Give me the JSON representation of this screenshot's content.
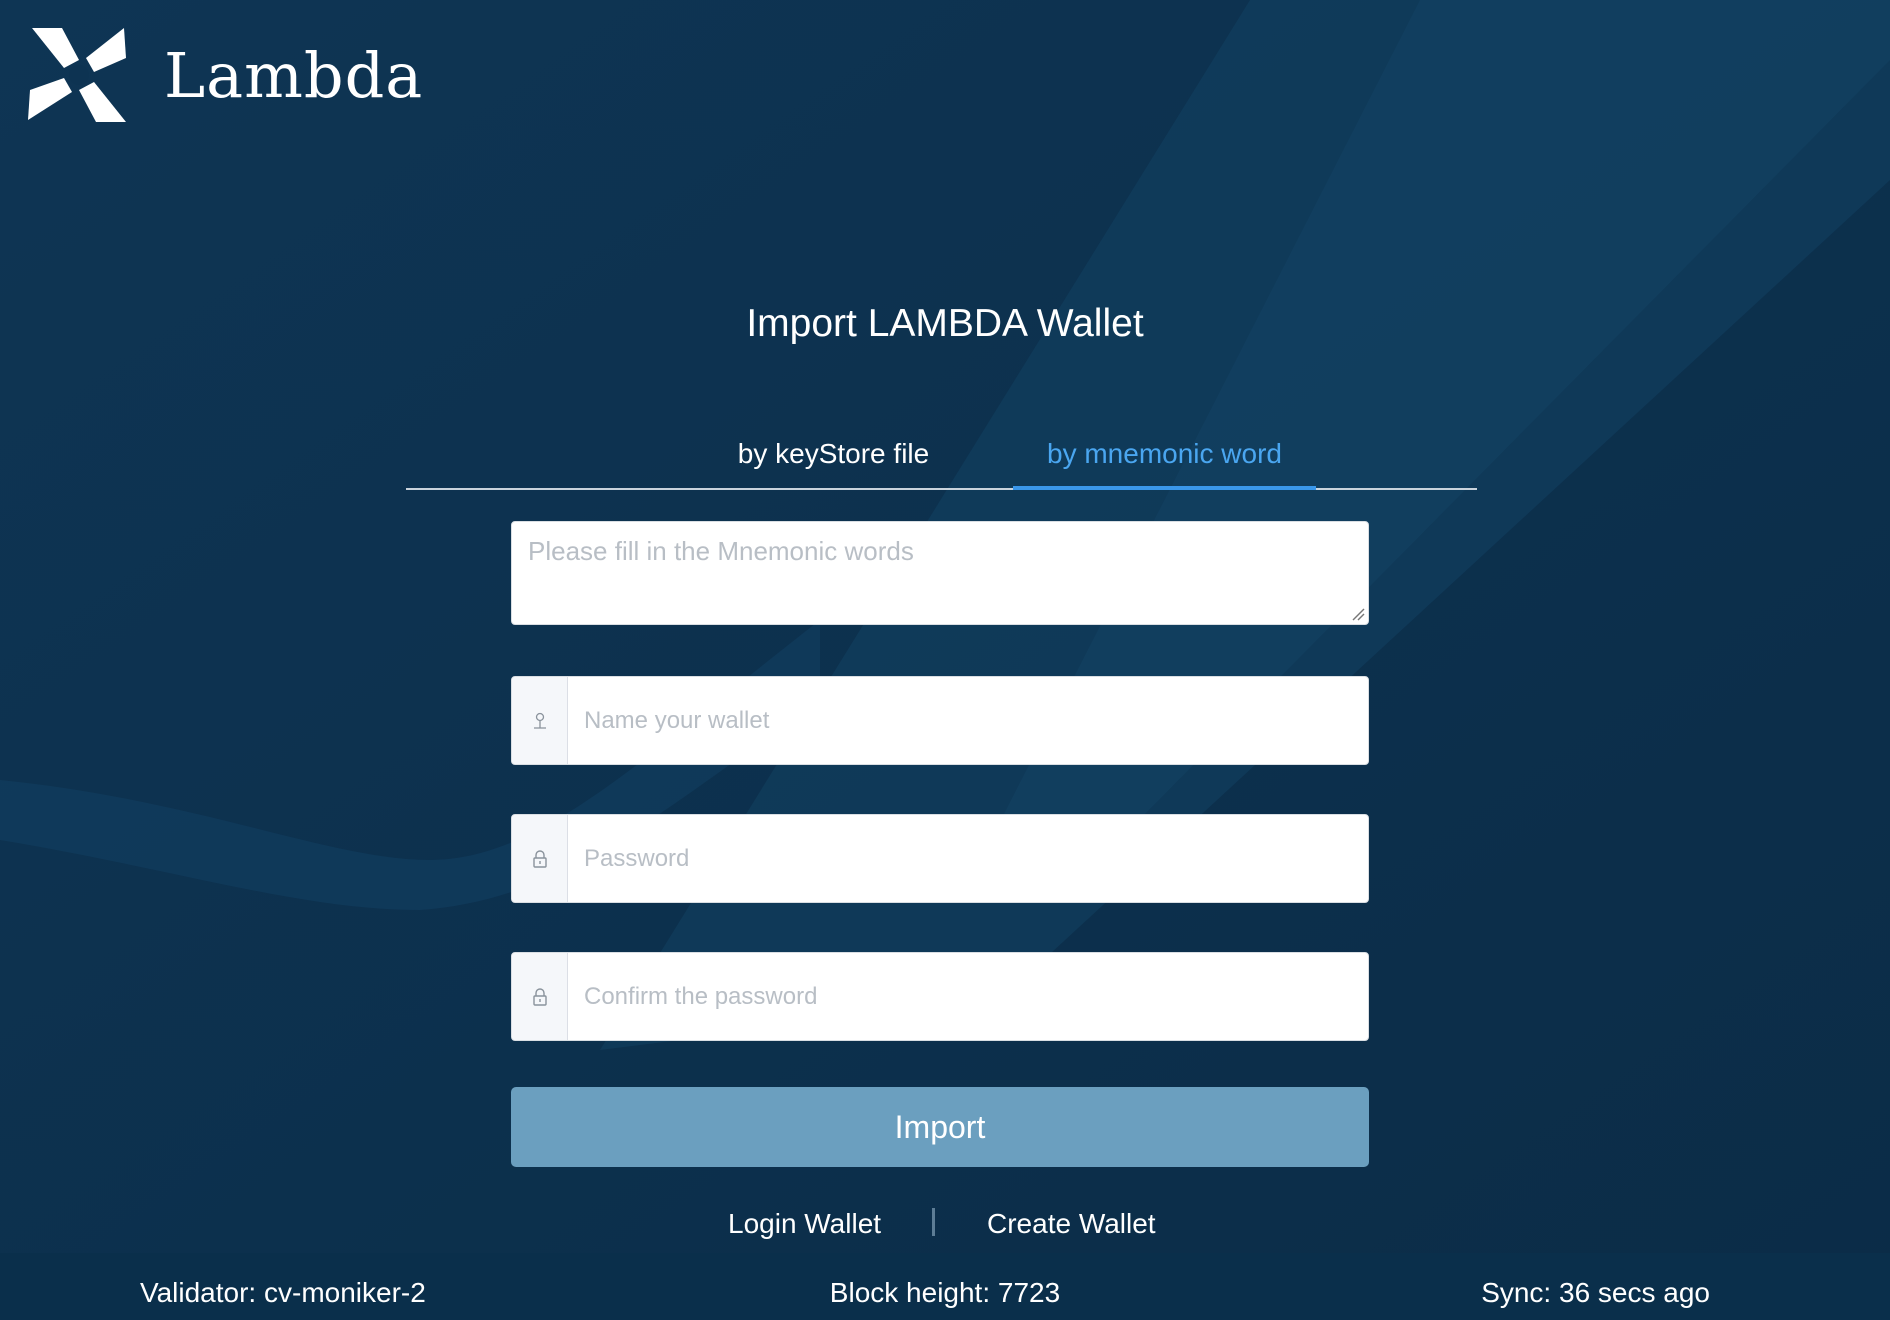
{
  "brand": {
    "name": "Lambda",
    "logo_icon": "lambda-logo-icon"
  },
  "page": {
    "title": "Import LAMBDA Wallet"
  },
  "tabs": [
    {
      "label": "by keyStore file",
      "active": false
    },
    {
      "label": "by mnemonic word",
      "active": true
    }
  ],
  "form": {
    "mnemonic_placeholder": "Please fill in the Mnemonic words",
    "mnemonic_value": "",
    "name_placeholder": "Name your wallet",
    "name_icon": "user-icon",
    "password_placeholder": "Password",
    "password_icon": "lock-icon",
    "confirm_placeholder": "Confirm the password",
    "confirm_icon": "lock-icon",
    "submit_label": "Import"
  },
  "links": {
    "login": "Login Wallet",
    "create": "Create Wallet"
  },
  "footer": {
    "validator": "Validator: cv-moniker-2",
    "block_height": "Block height: 7723",
    "sync": "Sync: 36 secs ago"
  },
  "colors": {
    "background": "#0d3352",
    "active_tab": "#4aa6f0",
    "tab_underline": "#3a97ea",
    "import_button": "#6b9fbf",
    "footer_bg": "#0a2f4b"
  }
}
